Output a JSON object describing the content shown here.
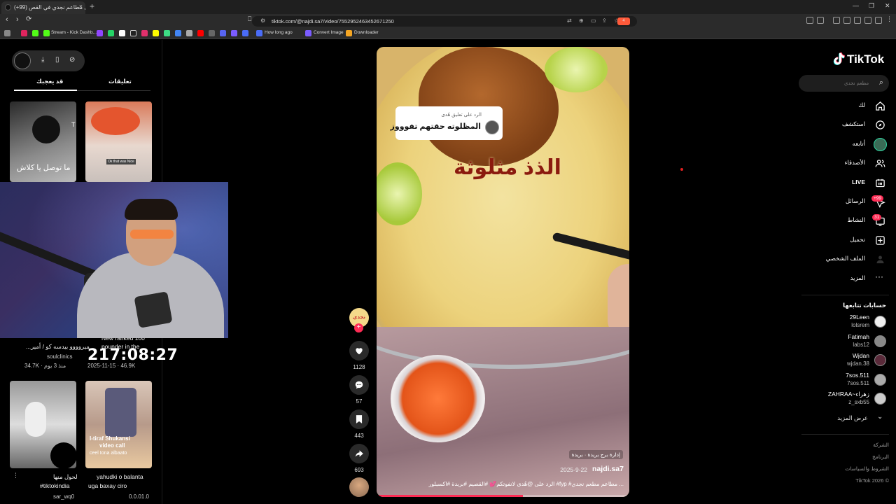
{
  "browser": {
    "tab_title": "(+99) أفضل مطاعم نجدي في القص",
    "new_tab": "+",
    "close_tab": "×",
    "url": "tiktok.com/@najdi.sa7/video/7552952463452671250",
    "notification_count": "4"
  },
  "bookmarks": [
    {
      "label": "Stream - Kick Dashb...",
      "color": "#53fc18"
    },
    {
      "label": "How long ago",
      "color": "#4a6cf7"
    },
    {
      "label": "Convert Image",
      "color": "#7b5cff"
    },
    {
      "label": "Downloader",
      "color": "#f5a623"
    }
  ],
  "left_panel": {
    "tabs": [
      "تعليقات",
      "قد يعجبك"
    ],
    "cards": [
      {
        "caption": "ما توصل يا كلاش",
        "sub": "T",
        "label": "Ok that was Nice"
      },
      {
        "caption": "",
        "sub": "",
        "label": ""
      }
    ],
    "mid_cards": [
      {
        "title": "...ميروووو بيدسه كو / أمير",
        "author": "soulclinics",
        "stats": "34.7K · منذ 3 يوم"
      },
      {
        "title": "New ranked 100 pounder in the",
        "author": "",
        "stats": "2025-11-15 · 46.9K"
      }
    ],
    "bottom_cards": [
      {
        "title": "لحول منها",
        "author": "#tiktokindia",
        "user": "sar_wq0"
      },
      {
        "title": "yahudki o balanta",
        "author": "uga baxay ciro",
        "user": "0.0.01.0",
        "overlay1": "I-tiraf Shukansi",
        "overlay2": "video call",
        "overlay3": "ceel Iona albaato"
      }
    ]
  },
  "webcam": {
    "timer": "217:08:27"
  },
  "video": {
    "reply_header": "الرد على تعليق هُدى",
    "reply_text": "المظلوته حقتهم تفوووز",
    "overlay_text": "الذذ مثلوثة",
    "location": "إدارة برج بريدة · بريدة",
    "username": "najdi.sa7",
    "date": "2025-9-22",
    "caption": "الرد على @هُدى   لانفوتكم💕 #القصيم #بريدة #اكسبلور #fyp #مطاعم  مطعم نجدي ..."
  },
  "actions": {
    "avatar_label": "نجدي",
    "likes": "1128",
    "comments": "57",
    "saves": "443",
    "shares": "693"
  },
  "right_nav": {
    "brand": "TikTok",
    "search_placeholder": "مطعم نجدي",
    "items": [
      {
        "label": "لك",
        "icon": "home-icon"
      },
      {
        "label": "استكشف",
        "icon": "compass-icon"
      },
      {
        "label": "أتابعه",
        "icon": "following-icon"
      },
      {
        "label": "الأصدقاء",
        "icon": "friends-icon"
      },
      {
        "label": "LIVE",
        "icon": "live-icon"
      },
      {
        "label": "الرسائل",
        "icon": "messages-icon",
        "badge": "+99"
      },
      {
        "label": "النشاط",
        "icon": "activity-icon",
        "badge": "31"
      },
      {
        "label": "تحميل",
        "icon": "upload-icon"
      },
      {
        "label": "الملف الشخصي",
        "icon": "profile-icon"
      },
      {
        "label": "المزيد",
        "icon": "more-icon"
      }
    ],
    "following_title": "حسابات تتابعها",
    "following": [
      {
        "name": "29Leen",
        "user": "lolsrem"
      },
      {
        "name": "Fatimah",
        "user": "labs12"
      },
      {
        "name": "Wjdan",
        "user": "wjdan.38"
      },
      {
        "name": "7sos.511",
        "user": "7sos.511"
      },
      {
        "name": "ZAHRAA~زهراء",
        "user": "z_sxb55"
      }
    ],
    "show_more": "عرض المزيد",
    "footer": [
      "الشركة",
      "البرنامج",
      "الشروط والسياسات",
      "TikTok 2026 ©"
    ]
  }
}
